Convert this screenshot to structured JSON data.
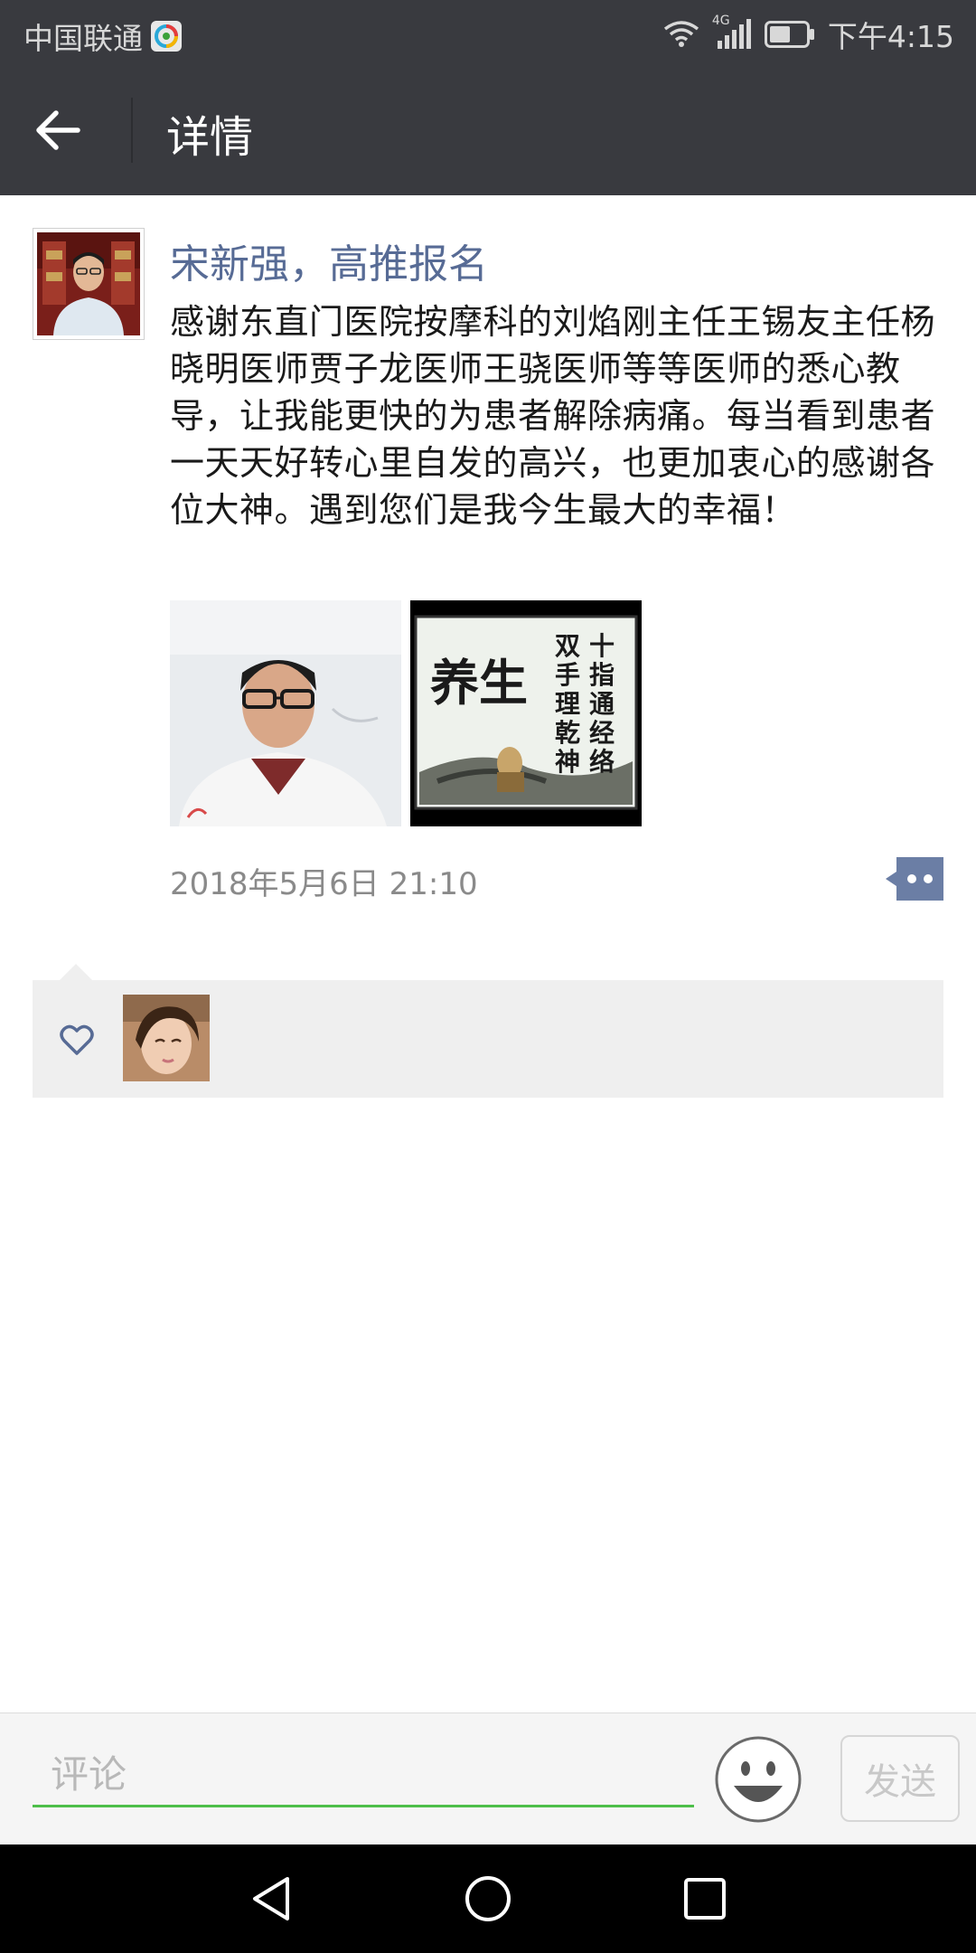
{
  "status_bar": {
    "carrier": "中国联通",
    "network": "4G",
    "time": "下午4:15"
  },
  "header": {
    "title": "详情"
  },
  "post": {
    "author": "宋新强，高推报名",
    "text": "感谢东直门医院按摩科的刘焰刚主任王锡友主任杨晓明医师贾子龙医师王骁医师等等医师的悉心教导，让我能更快的为患者解除病痛。每当看到患者一天天好转心里自发的高兴，也更加衷心的感谢各位大神。遇到您们是我今生最大的幸福！",
    "images": [
      {
        "name": "selfie-photo"
      },
      {
        "name": "poster-image",
        "calligraphy_left": "养生",
        "calligraphy_right": "十指通经络 双手理乾神"
      }
    ],
    "timestamp": "2018年5月6日 21:10"
  },
  "likes": {
    "count": 1
  },
  "comment_bar": {
    "placeholder": "评论",
    "send_label": "发送"
  },
  "colors": {
    "topbar": "#393a3f",
    "author_link": "#576b95",
    "input_underline": "#4dbf4a",
    "likes_bg": "#efefef"
  },
  "icons": [
    "back-arrow-icon",
    "more-comment-icon",
    "heart-icon",
    "emoji-icon",
    "nav-back-icon",
    "nav-home-icon",
    "nav-recent-icon"
  ]
}
